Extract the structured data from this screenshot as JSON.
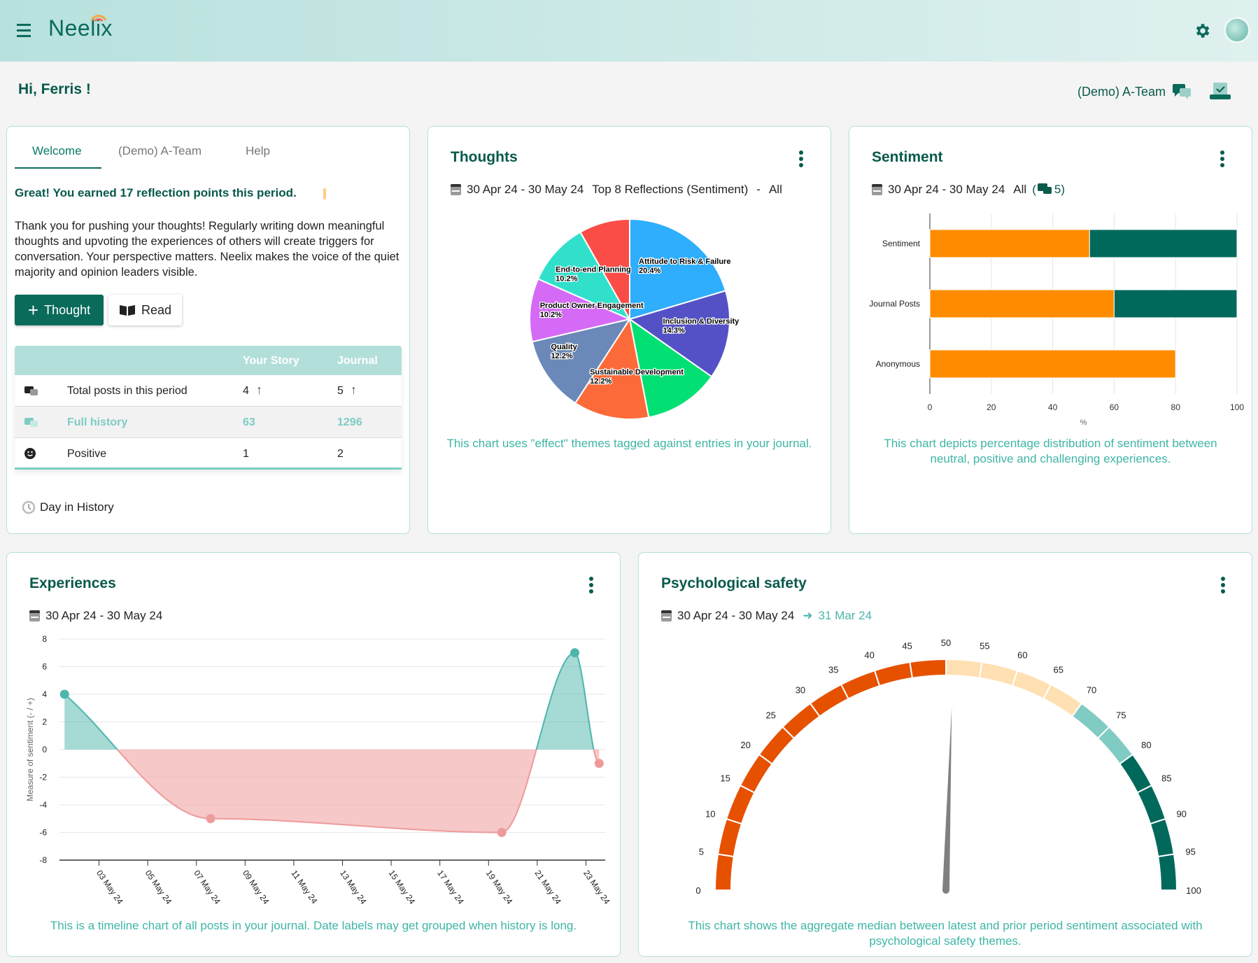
{
  "header": {
    "brand": "Neelix",
    "menu_icon": "hamburger-icon",
    "settings_icon": "gear-icon",
    "avatar_icon": "avatar"
  },
  "greeting": "Hi, Ferris !",
  "team": {
    "label": "(Demo) A-Team",
    "chat_icon": "chat-bubbles-icon",
    "inbox_icon": "inbox-check-icon"
  },
  "welcome_card": {
    "tabs": [
      {
        "label": "Welcome",
        "active": true
      },
      {
        "label": "(Demo) A-Team"
      },
      {
        "label": "Help"
      }
    ],
    "points_text": "Great! You earned 17 reflection points this period.",
    "body": "Thank you for pushing your thoughts! Regularly writing down meaningful thoughts and upvoting the experiences of others will create triggers for conversation. Your perspective matters. Neelix makes the voice of the quiet majority and opinion leaders visible.",
    "thought_button": "Thought",
    "read_button": "Read",
    "table": {
      "headers": [
        "",
        "",
        "Your Story",
        "Journal"
      ],
      "rows": [
        {
          "icon": "chat-bubbles-icon",
          "label": "Total posts in this period",
          "story": "4",
          "journal": "5",
          "trend": "up"
        },
        {
          "icon": "chat-bubbles-icon",
          "label": "Full history",
          "story": "63",
          "journal": "1296"
        },
        {
          "icon": "smiley-icon",
          "label": "Positive",
          "story": "1",
          "journal": "2"
        }
      ]
    },
    "day_in_history": "Day in History"
  },
  "thoughts_card": {
    "title": "Thoughts",
    "date_range": "30 Apr 24 - 30 May 24",
    "filter": "Top 8 Reflections (Sentiment)",
    "sep": "-",
    "scope": "All",
    "caption": "This chart uses \"effect\" themes tagged against entries in your journal."
  },
  "sentiment_card": {
    "title": "Sentiment",
    "date_range": "30 Apr 24 - 30 May 24",
    "scope": "All",
    "count_open": "(",
    "count": "5)",
    "caption": "This chart depicts percentage distribution of sentiment between neutral, positive and challenging experiences."
  },
  "experiences_card": {
    "title": "Experiences",
    "date_range": "30 Apr 24 - 30 May 24",
    "caption": "This is a timeline chart of all posts in your journal. Date labels may get grouped when history is long."
  },
  "psych_card": {
    "title": "Psychological safety",
    "date_range": "30 Apr 24 - 30 May 24",
    "compare": "31 Mar 24",
    "caption": "This chart shows the aggregate median between latest and prior period sentiment associated with psychological safety themes."
  },
  "chart_data": [
    {
      "type": "pie",
      "slices": [
        {
          "name": "Attitude to Risk & Failure",
          "value": 20.4,
          "label": "20.4%",
          "color": "#2eaefc"
        },
        {
          "name": "Inclusion & Diversity",
          "value": 14.3,
          "label": "14.3%",
          "color": "#5451c6"
        },
        {
          "name": "",
          "value": 12.2,
          "label": "",
          "color": "#03e073"
        },
        {
          "name": "Sustainable Development",
          "value": 12.2,
          "label": "12.2%",
          "color": "#fd6a39"
        },
        {
          "name": "Quality",
          "value": 12.2,
          "label": "12.2%",
          "color": "#6a89b8"
        },
        {
          "name": "Product Owner Engagement",
          "value": 10.2,
          "label": "10.2%",
          "color": "#d46af6"
        },
        {
          "name": "End-to-end Planning",
          "value": 10.2,
          "label": "10.2%",
          "color": "#30e0cb"
        },
        {
          "name": "",
          "value": 8.2,
          "label": "",
          "color": "#fa4d48"
        }
      ]
    },
    {
      "type": "bar",
      "orientation": "horizontal",
      "stacked": true,
      "categories": [
        "Sentiment",
        "Journal Posts",
        "Anonymous"
      ],
      "series": [
        {
          "values": [
            52,
            60,
            80
          ],
          "color": "#ff8c00"
        },
        {
          "values": [
            48,
            40,
            0
          ],
          "color": "#00695c"
        }
      ],
      "xlabel": "%",
      "xlim": [
        0,
        100
      ],
      "xticks": [
        "0",
        "20",
        "40",
        "60",
        "80",
        "100"
      ],
      "grid": true
    },
    {
      "type": "area",
      "ylabel": "Measure of sentiment (- / +)",
      "ylim": [
        -8,
        8
      ],
      "yticks": [
        "8",
        "6",
        "4",
        "2",
        "0",
        "-2",
        "-4",
        "-6",
        "-8"
      ],
      "xlim": [
        "2024-05-01T09:00",
        "2024-05-23T19:00"
      ],
      "xticks": [
        {
          "date": "2024-05-03",
          "label": "03 May 24"
        },
        {
          "date": "2024-05-05",
          "label": "05 May 24"
        },
        {
          "date": "2024-05-07",
          "label": "07 May 24"
        },
        {
          "date": "2024-05-09",
          "label": "09 May 24"
        },
        {
          "date": "2024-05-11",
          "label": "11 May 24"
        },
        {
          "date": "2024-05-13",
          "label": "13 May 24"
        },
        {
          "date": "2024-05-15",
          "label": "15 May 24"
        },
        {
          "date": "2024-05-17",
          "label": "17 May 24"
        },
        {
          "date": "2024-05-19",
          "label": "19 May 24"
        },
        {
          "date": "2024-05-21",
          "label": "21 May 24"
        },
        {
          "date": "2024-05-23",
          "label": "23 May 24"
        }
      ],
      "points": [
        {
          "x": "2024-05-01T14:00",
          "y": 4
        },
        {
          "x": "2024-05-07T14:00",
          "y": -5
        },
        {
          "x": "2024-05-19T13:00",
          "y": -6
        },
        {
          "x": "2024-05-22T13:00",
          "y": 7
        },
        {
          "x": "2024-05-23T13:00",
          "y": -1
        }
      ],
      "positive_color": "#4db6ac",
      "negative_color": "#ef9a9a",
      "grid": true
    },
    {
      "type": "gauge",
      "min": 0,
      "max": 100,
      "value": 51,
      "ticks": [
        "0",
        "5",
        "10",
        "15",
        "20",
        "25",
        "30",
        "35",
        "40",
        "45",
        "50",
        "55",
        "60",
        "65",
        "70",
        "75",
        "80",
        "85",
        "90",
        "95",
        "100"
      ],
      "bands": [
        {
          "from": 0,
          "to": 50,
          "color": "#e65100"
        },
        {
          "from": 50,
          "to": 70,
          "color": "#ffe0b2"
        },
        {
          "from": 70,
          "to": 80,
          "color": "#80cbc4"
        },
        {
          "from": 80,
          "to": 100,
          "color": "#00695c"
        }
      ]
    }
  ]
}
